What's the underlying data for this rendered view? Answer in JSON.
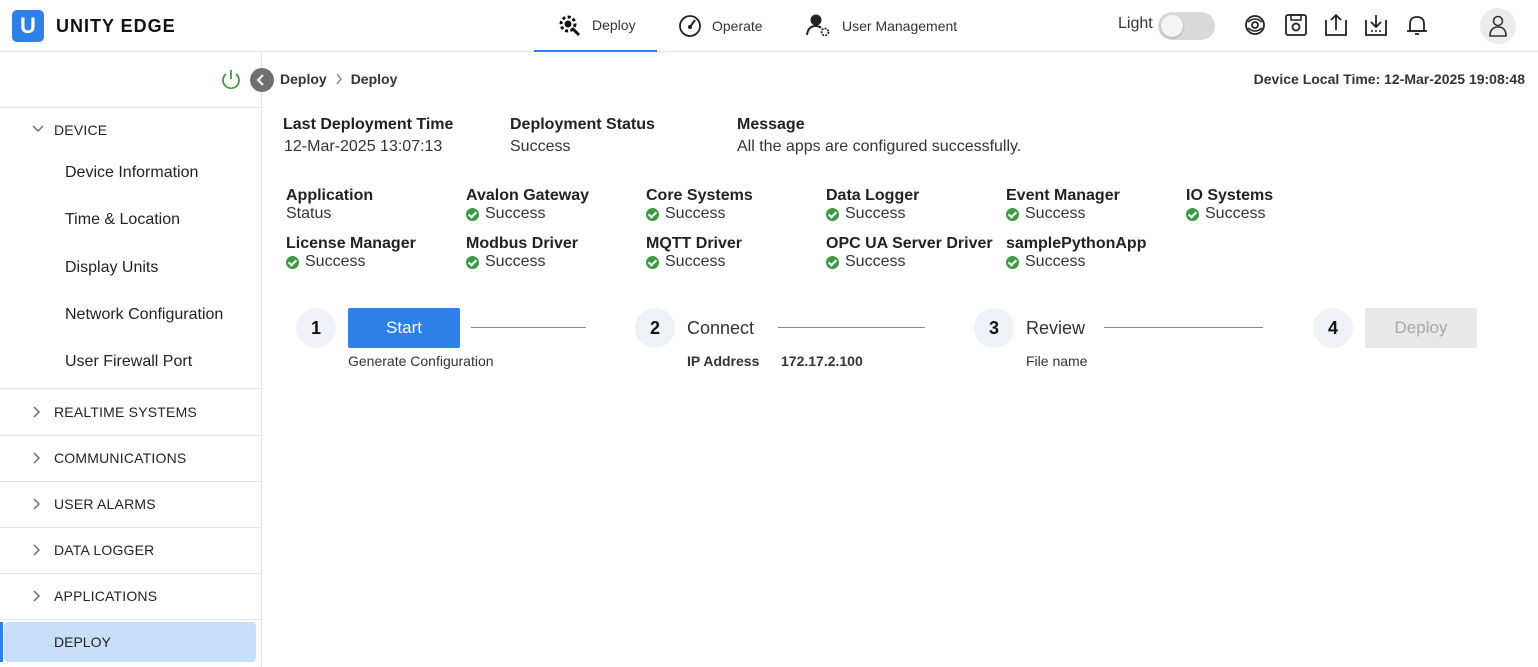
{
  "header": {
    "logo_letter": "U",
    "app_title": "UNITY EDGE",
    "tabs": [
      {
        "label": "Deploy",
        "icon": "deploy-gear-icon",
        "active": true
      },
      {
        "label": "Operate",
        "icon": "gauge-icon",
        "active": false
      },
      {
        "label": "User Management",
        "icon": "user-gear-icon",
        "active": false
      }
    ],
    "theme_label": "Light",
    "accent_color": "#2e7fe8"
  },
  "sidebar": {
    "sections": [
      {
        "label": "DEVICE",
        "expanded": true,
        "items": [
          "Device Information",
          "Time & Location",
          "Display Units",
          "Network Configuration",
          "User Firewall Port"
        ]
      },
      {
        "label": "REALTIME SYSTEMS",
        "expanded": false
      },
      {
        "label": "COMMUNICATIONS",
        "expanded": false
      },
      {
        "label": "USER ALARMS",
        "expanded": false
      },
      {
        "label": "DATA LOGGER",
        "expanded": false
      },
      {
        "label": "APPLICATIONS",
        "expanded": false
      }
    ],
    "active_item": "DEPLOY"
  },
  "breadcrumb": [
    "Deploy",
    "Deploy"
  ],
  "device_time": "Device Local Time: 12-Mar-2025 19:08:48",
  "deployment": {
    "last_time_label": "Last Deployment Time",
    "last_time_value": "12-Mar-2025 13:07:13",
    "status_label": "Deployment Status",
    "status_value": "Success",
    "message_label": "Message",
    "message_value": "All the apps are configured successfully."
  },
  "applications": {
    "header_label": "Application",
    "header_sub": "Status",
    "items": [
      {
        "name": "Avalon Gateway",
        "status": "Success"
      },
      {
        "name": "Core Systems",
        "status": "Success"
      },
      {
        "name": "Data Logger",
        "status": "Success"
      },
      {
        "name": "Event Manager",
        "status": "Success"
      },
      {
        "name": "IO Systems",
        "status": "Success"
      },
      {
        "name": "License Manager",
        "status": "Success"
      },
      {
        "name": "Modbus Driver",
        "status": "Success"
      },
      {
        "name": "MQTT Driver",
        "status": "Success"
      },
      {
        "name": "OPC UA Server Driver",
        "status": "Success"
      },
      {
        "name": "samplePythonApp",
        "status": "Success"
      }
    ],
    "success_color": "#3f9a44"
  },
  "steps": [
    {
      "number": "1",
      "button": "Start",
      "subtitle": "Generate Configuration"
    },
    {
      "number": "2",
      "title": "Connect",
      "ip_label": "IP Address",
      "ip_value": "172.17.2.100"
    },
    {
      "number": "3",
      "title": "Review",
      "subtitle": "File name"
    },
    {
      "number": "4",
      "button": "Deploy"
    }
  ]
}
